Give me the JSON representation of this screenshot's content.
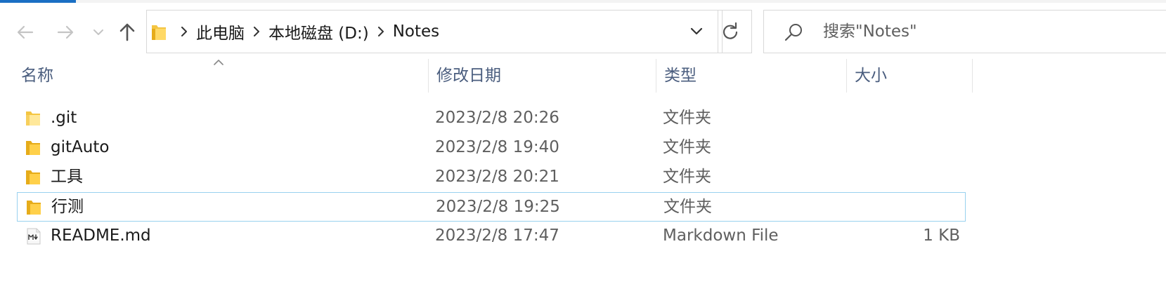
{
  "nav": {
    "back_icon": "arrow-left-icon",
    "forward_icon": "arrow-right-icon",
    "recent_icon": "chevron-down-icon",
    "up_icon": "arrow-up-icon"
  },
  "address": {
    "folder_icon": "folder-icon",
    "crumbs": [
      "此电脑",
      "本地磁盘 (D:)",
      "Notes"
    ],
    "dropdown_icon": "chevron-down-icon"
  },
  "refresh_icon": "refresh-icon",
  "search": {
    "icon": "search-icon",
    "placeholder": "搜索\"Notes\""
  },
  "columns": {
    "name": "名称",
    "date": "修改日期",
    "type": "类型",
    "size": "大小",
    "sorted_by": "名称",
    "sort_direction": "ascending"
  },
  "files": [
    {
      "name": ".git",
      "date": "2023/2/8 20:26",
      "type": "文件夹",
      "size": "",
      "icon": "folder-icon",
      "selected": false
    },
    {
      "name": "gitAuto",
      "date": "2023/2/8 19:40",
      "type": "文件夹",
      "size": "",
      "icon": "folder-icon",
      "selected": false
    },
    {
      "name": "工具",
      "date": "2023/2/8 20:21",
      "type": "文件夹",
      "size": "",
      "icon": "folder-icon",
      "selected": false
    },
    {
      "name": "行测",
      "date": "2023/2/8 19:25",
      "type": "文件夹",
      "size": "",
      "icon": "folder-icon",
      "selected": true
    },
    {
      "name": "README.md",
      "date": "2023/2/8 17:47",
      "type": "Markdown File",
      "size": "1 KB",
      "icon": "markdown-file-icon",
      "selected": false
    }
  ],
  "colors": {
    "accent": "#1a6fc4",
    "header_text": "#4a5d7e",
    "selection_border": "#99d1ef",
    "folder": "#f4c542"
  }
}
